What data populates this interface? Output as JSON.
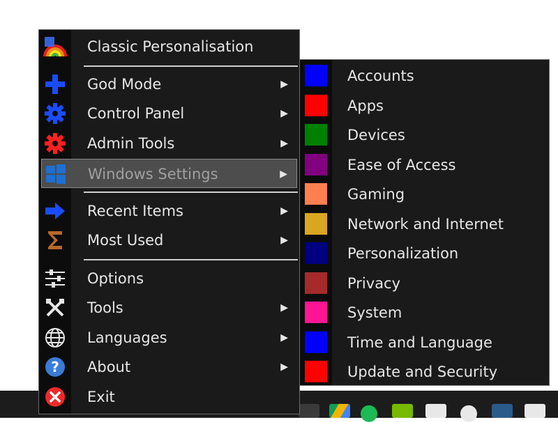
{
  "main_menu": {
    "items": [
      {
        "label": "Classic Personalisation",
        "icon": "rainbow-icon",
        "submenu": false
      },
      {
        "label": "God Mode",
        "icon": "plus-icon",
        "submenu": true
      },
      {
        "label": "Control Panel",
        "icon": "gear-blue-icon",
        "submenu": true
      },
      {
        "label": "Admin Tools",
        "icon": "gear-red-icon",
        "submenu": true
      },
      {
        "label": "Windows Settings",
        "icon": "windows-logo-icon",
        "submenu": true,
        "highlighted": true
      },
      {
        "label": "Recent Items",
        "icon": "arrow-right-icon",
        "submenu": true
      },
      {
        "label": "Most Used",
        "icon": "sigma-icon",
        "submenu": true
      },
      {
        "label": "Options",
        "icon": "sliders-icon",
        "submenu": false
      },
      {
        "label": "Tools",
        "icon": "tools-icon",
        "submenu": true
      },
      {
        "label": "Languages",
        "icon": "globe-icon",
        "submenu": true
      },
      {
        "label": "About",
        "icon": "question-icon",
        "submenu": true
      },
      {
        "label": "Exit",
        "icon": "close-circle-icon",
        "submenu": false
      }
    ],
    "arrow_glyph": "▶"
  },
  "windows_settings_submenu": {
    "items": [
      {
        "label": "Accounts",
        "color": "#0000ff"
      },
      {
        "label": "Apps",
        "color": "#ff0000"
      },
      {
        "label": "Devices",
        "color": "#008000"
      },
      {
        "label": "Ease of Access",
        "color": "#800080"
      },
      {
        "label": "Gaming",
        "color": "#ff7f50"
      },
      {
        "label": "Network and Internet",
        "color": "#daa520"
      },
      {
        "label": "Personalization",
        "color": "#000080"
      },
      {
        "label": "Privacy",
        "color": "#a52a2a"
      },
      {
        "label": "System",
        "color": "#ff1493"
      },
      {
        "label": "Time and Language",
        "color": "#0000ff"
      },
      {
        "label": "Update and Security",
        "color": "#ff0000"
      }
    ]
  },
  "taskbar": {
    "tray_icons": [
      "equalizer-icon",
      "google-drive-icon",
      "spotify-icon",
      "nvidia-icon",
      "photos-icon",
      "github-icon",
      "app-icon",
      "printer-icon"
    ]
  }
}
